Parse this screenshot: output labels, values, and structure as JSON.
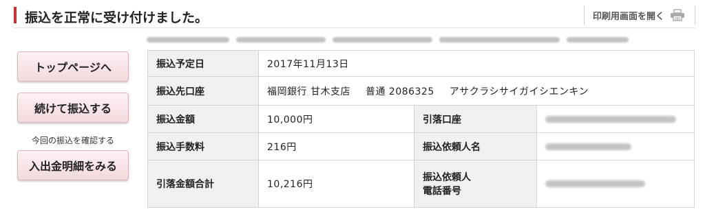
{
  "header": {
    "title": "振込を正常に受け付けました。",
    "print_label": "印刷用画面を開く",
    "accent_color": "#c9302c"
  },
  "sidebar": {
    "top_button": "トップページへ",
    "continue_button": "続けて振込する",
    "note": "今回の振込を確認する",
    "statement_button": "入出金明細をみる"
  },
  "transfer": {
    "date_label": "振込予定日",
    "date_value": "2017年11月13日",
    "dest_label": "振込先口座",
    "dest_bank": "福岡銀行 甘木支店",
    "dest_type": "普通",
    "dest_number": "2086325",
    "dest_name": "アサクラシサイガイシエンキン",
    "amount_label": "振込金額",
    "amount_value": "10,000円",
    "fee_label": "振込手数料",
    "fee_value": "216円",
    "total_label": "引落金額合計",
    "total_value": "10,216円",
    "debit_account_label": "引落口座",
    "requester_label": "振込依頼人名",
    "phone_label_line1": "振込依頼人",
    "phone_label_line2": "電話番号"
  }
}
